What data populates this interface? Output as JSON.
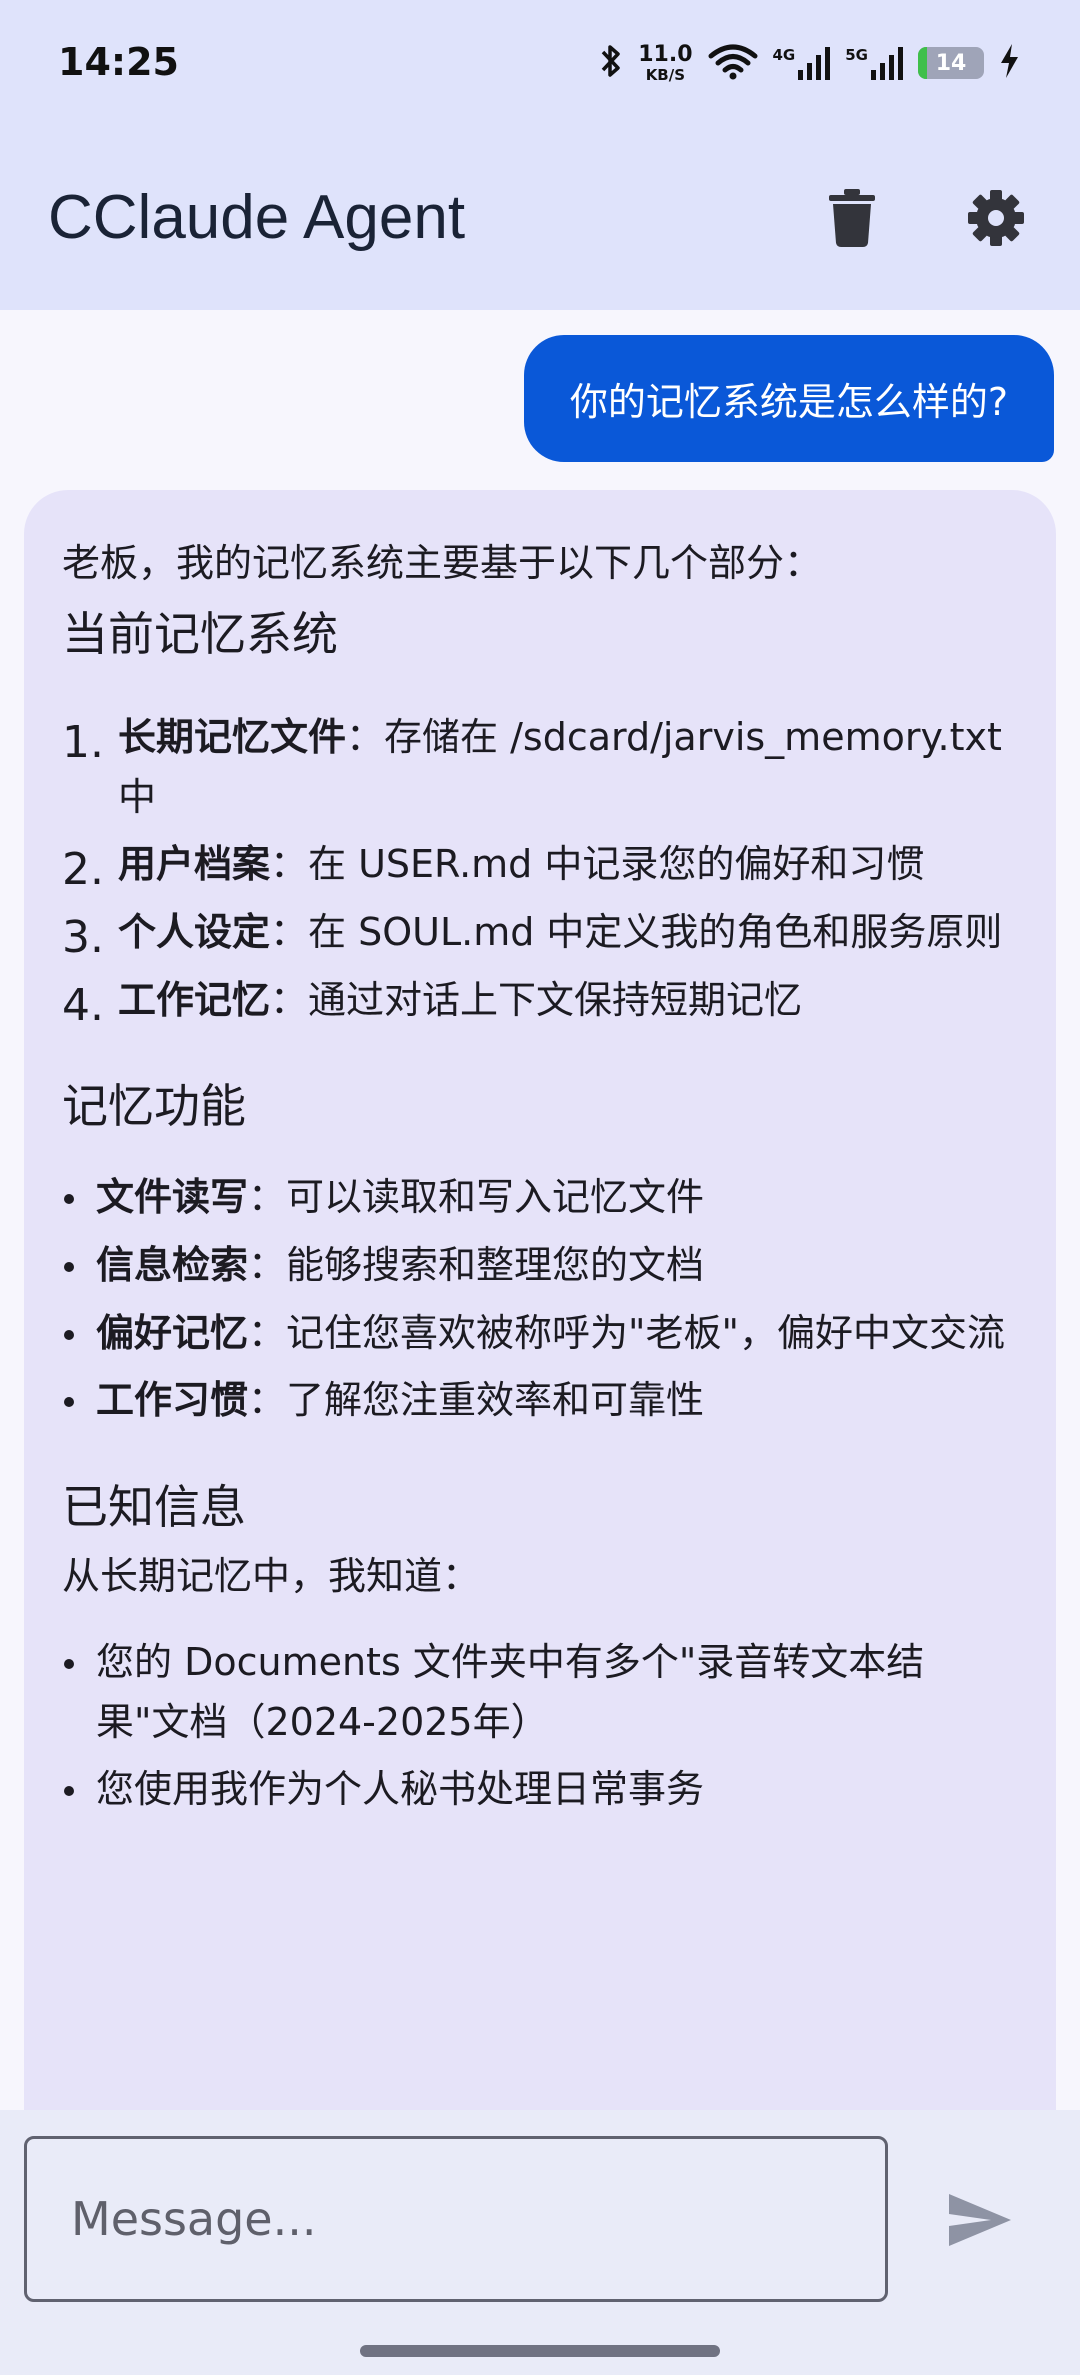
{
  "status_bar": {
    "time": "14:25",
    "net_speed": "11.0",
    "net_speed_unit": "KB/S",
    "sig1_label": "4G",
    "sig2_label": "5G",
    "battery_level": "14",
    "icons": [
      "bluetooth-icon",
      "wifi-icon",
      "cellular-4g-icon",
      "cellular-5g-icon",
      "battery-icon",
      "charging-bolt-icon"
    ]
  },
  "app_bar": {
    "title": "CClaude Agent",
    "delete_icon": "trash-icon",
    "settings_icon": "gear-icon"
  },
  "chat": {
    "user_message": "你的记忆系统是怎么样的?",
    "assistant": {
      "intro": "老板，我的记忆系统主要基于以下几个部分：",
      "section1_title": "当前记忆系统",
      "numbered": [
        {
          "num": "1.",
          "title": "长期记忆文件",
          "text": "：存储在 /sdcard/jarvis_memory.txt 中"
        },
        {
          "num": "2.",
          "title": "用户档案",
          "text": "：在 USER.md 中记录您的偏好和习惯"
        },
        {
          "num": "3.",
          "title": "个人设定",
          "text": "：在 SOUL.md 中定义我的角色和服务原则"
        },
        {
          "num": "4.",
          "title": "工作记忆",
          "text": "：通过对话上下文保持短期记忆"
        }
      ],
      "section2_title": "记忆功能",
      "features": [
        {
          "title": "文件读写",
          "text": "：可以读取和写入记忆文件"
        },
        {
          "title": "信息检索",
          "text": "：能够搜索和整理您的文档"
        },
        {
          "title": "偏好记忆",
          "text": "：记住您喜欢被称呼为\"老板\"，偏好中文交流"
        },
        {
          "title": "工作习惯",
          "text": "：了解您注重效率和可靠性"
        }
      ],
      "section3_title": "已知信息",
      "section3_intro": "从长期记忆中，我知道：",
      "known": [
        "您的 Documents 文件夹中有多个\"录音转文本结果\"文档（2024-2025年）",
        "您使用我作为个人秘书处理日常事务"
      ]
    }
  },
  "composer": {
    "placeholder": "Message...",
    "send_icon": "send-icon"
  },
  "colors": {
    "header_bg": "#dfe3fb",
    "user_bubble": "#0a58d8",
    "assistant_bubble": "#e6e3f9"
  }
}
